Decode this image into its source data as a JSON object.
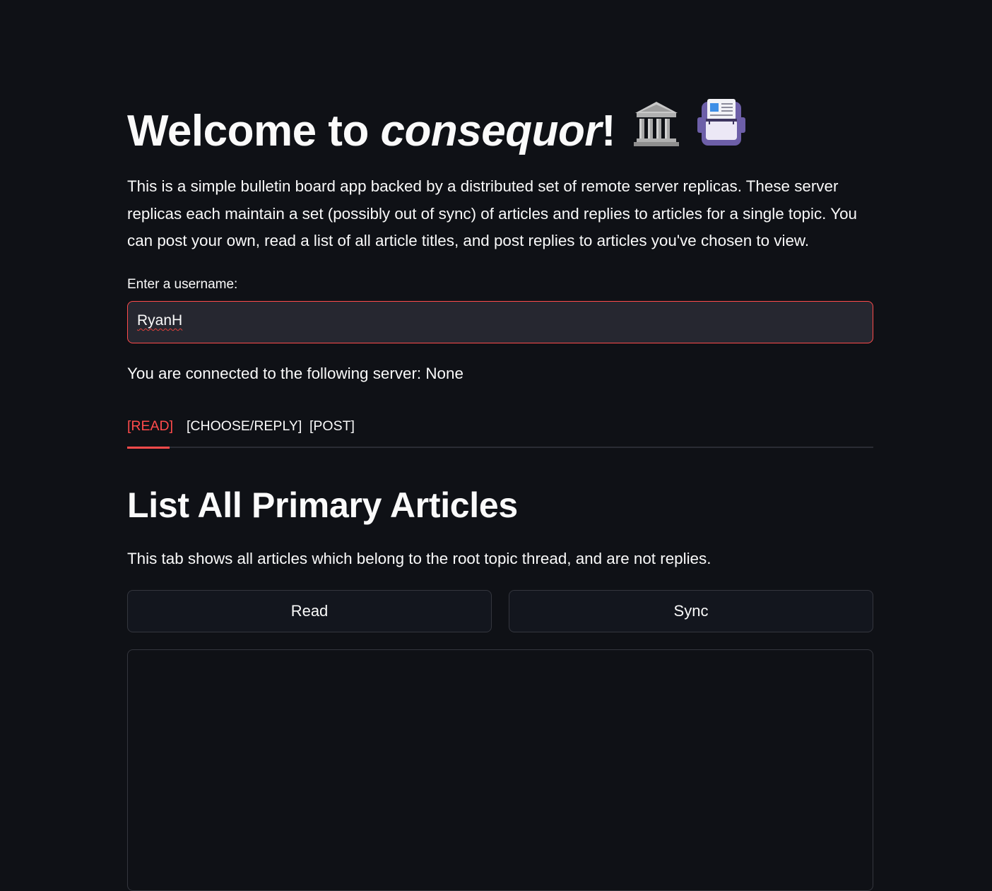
{
  "header": {
    "title_prefix": "Welcome to ",
    "title_app": "consequor",
    "title_suffix": "!",
    "icons": [
      "classical-building-icon",
      "newspaper-box-icon"
    ]
  },
  "intro_text": "This is a simple bulletin board app backed by a distributed set of remote server replicas. These server replicas each maintain a set (possibly out of sync) of articles and replies to articles for a single topic. You can post your own, read a list of all article titles, and post replies to articles you've chosen to view.",
  "username": {
    "label": "Enter a username:",
    "value": "RyanH"
  },
  "server_status": "You are connected to the following server: None",
  "tabs": [
    {
      "label": "[READ]",
      "active": true
    },
    {
      "label": "[CHOOSE/REPLY]",
      "active": false
    },
    {
      "label": "[POST]",
      "active": false
    }
  ],
  "section": {
    "title": "List All Primary Articles",
    "description": "This tab shows all articles which belong to the root topic thread, and are not replies."
  },
  "buttons": {
    "read": "Read",
    "sync": "Sync"
  },
  "colors": {
    "background": "#0f1116",
    "accent": "#ff4b4b",
    "input_bg": "#262730",
    "text": "#fafafa"
  }
}
